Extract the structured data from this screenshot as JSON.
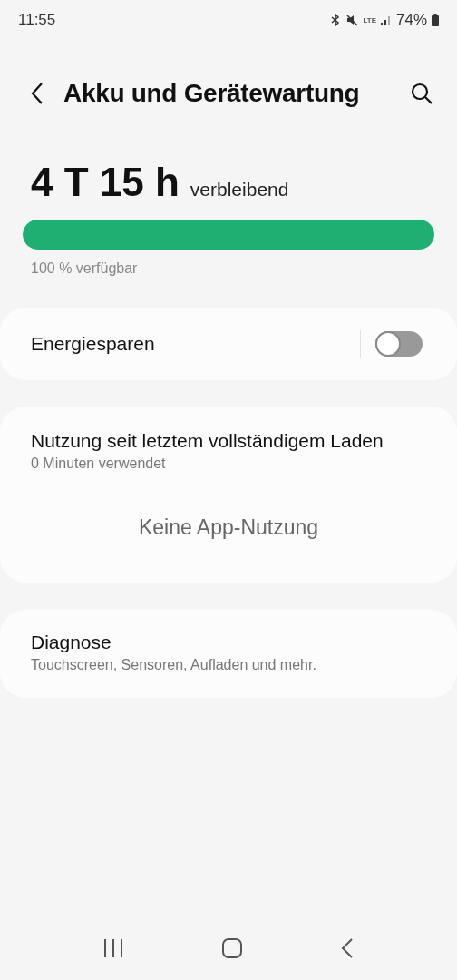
{
  "status_bar": {
    "time": "11:55",
    "network": "LTE",
    "battery": "74%"
  },
  "header": {
    "title": "Akku und Gerätewartung"
  },
  "battery": {
    "remaining": "4 T 15 h",
    "remaining_label": "verbleibend",
    "level": 1,
    "available": "100 % verfügbar"
  },
  "power_saving": {
    "label": "Energiesparen",
    "on": false
  },
  "usage": {
    "title": "Nutzung seit letztem vollständigem Laden",
    "subtitle": "0 Minuten verwendet",
    "empty": "Keine App-Nutzung"
  },
  "diagnostics": {
    "title": "Diagnose",
    "subtitle": "Touchscreen, Sensoren, Aufladen und mehr."
  }
}
